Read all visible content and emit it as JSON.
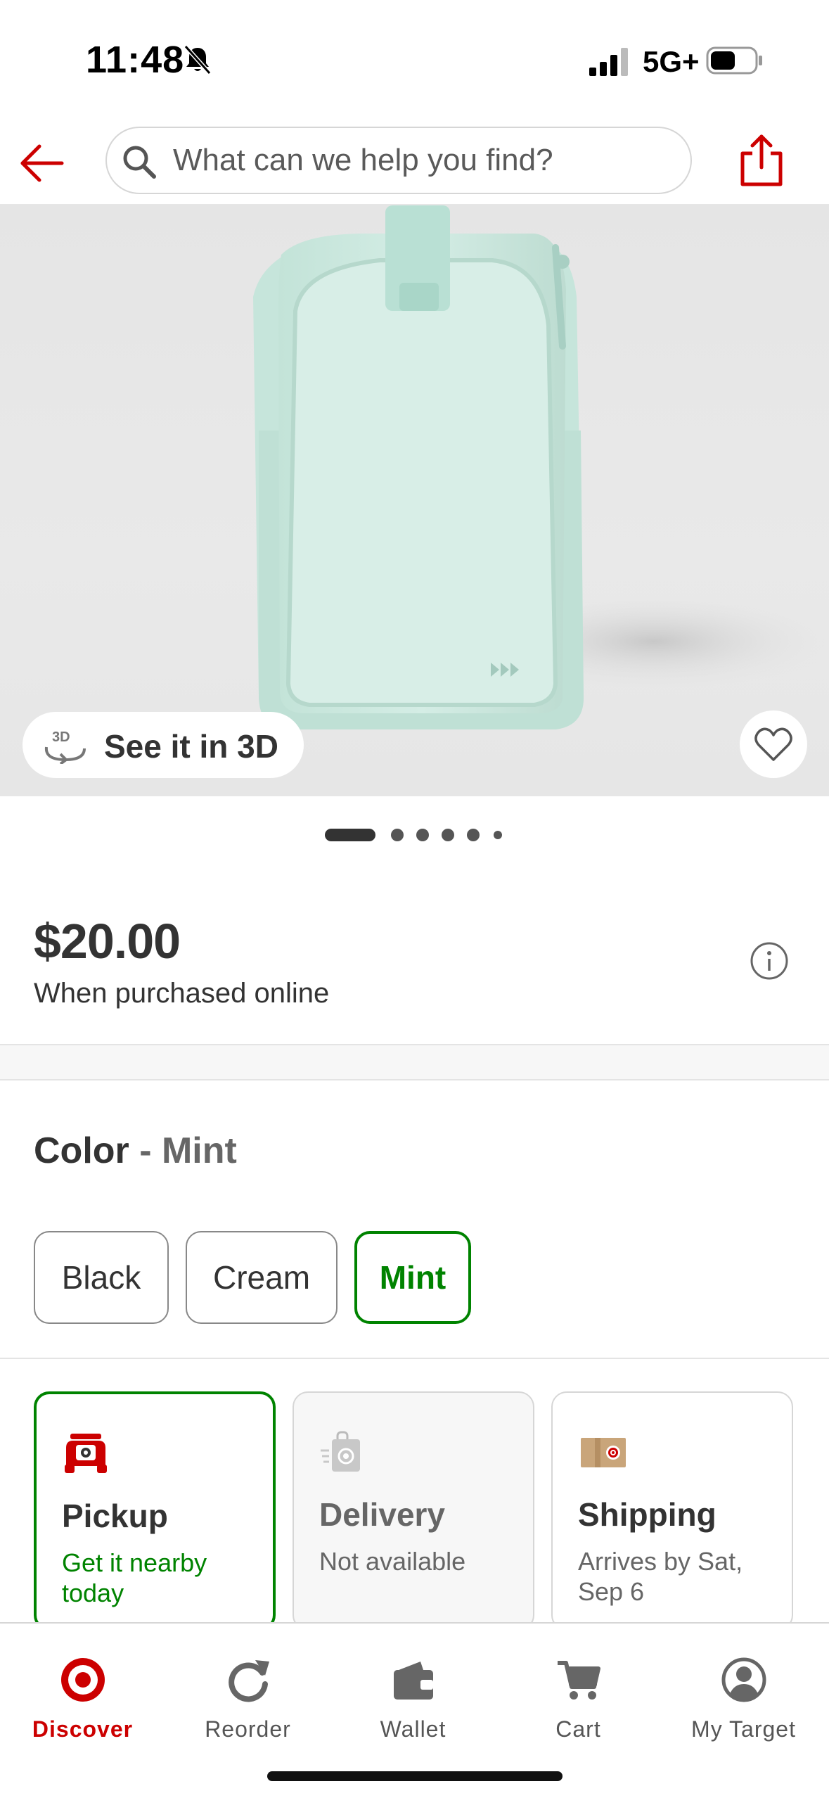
{
  "status_bar": {
    "time": "11:48",
    "network": "5G+"
  },
  "header": {
    "search_placeholder": "What can we help you find?"
  },
  "product": {
    "see_3d_label": "See it in 3D",
    "three_d_glyph": "3D",
    "carousel": {
      "total": 6,
      "active": 0
    },
    "price": "$20.00",
    "price_note": "When purchased online"
  },
  "color": {
    "label": "Color",
    "separator": " - ",
    "selected": "Mint",
    "options": [
      "Black",
      "Cream",
      "Mint"
    ]
  },
  "fulfillment": [
    {
      "title": "Pickup",
      "subtitle": "Get it nearby today",
      "state": "selected",
      "icon": "pickup-car-icon"
    },
    {
      "title": "Delivery",
      "subtitle": "Not available",
      "state": "disabled",
      "icon": "delivery-bag-icon"
    },
    {
      "title": "Shipping",
      "subtitle": "Arrives by Sat, Sep 6",
      "state": "default",
      "icon": "shipping-box-icon"
    }
  ],
  "nav": [
    {
      "label": "Discover",
      "icon": "target-logo-icon",
      "active": true
    },
    {
      "label": "Reorder",
      "icon": "reorder-icon",
      "active": false
    },
    {
      "label": "Wallet",
      "icon": "wallet-icon",
      "active": false
    },
    {
      "label": "Cart",
      "icon": "cart-icon",
      "active": false
    },
    {
      "label": "My Target",
      "icon": "account-icon",
      "active": false
    }
  ],
  "colors": {
    "brand_red": "#cc0000",
    "success_green": "#008300",
    "text": "#333333",
    "mint": "#c9e9df"
  }
}
